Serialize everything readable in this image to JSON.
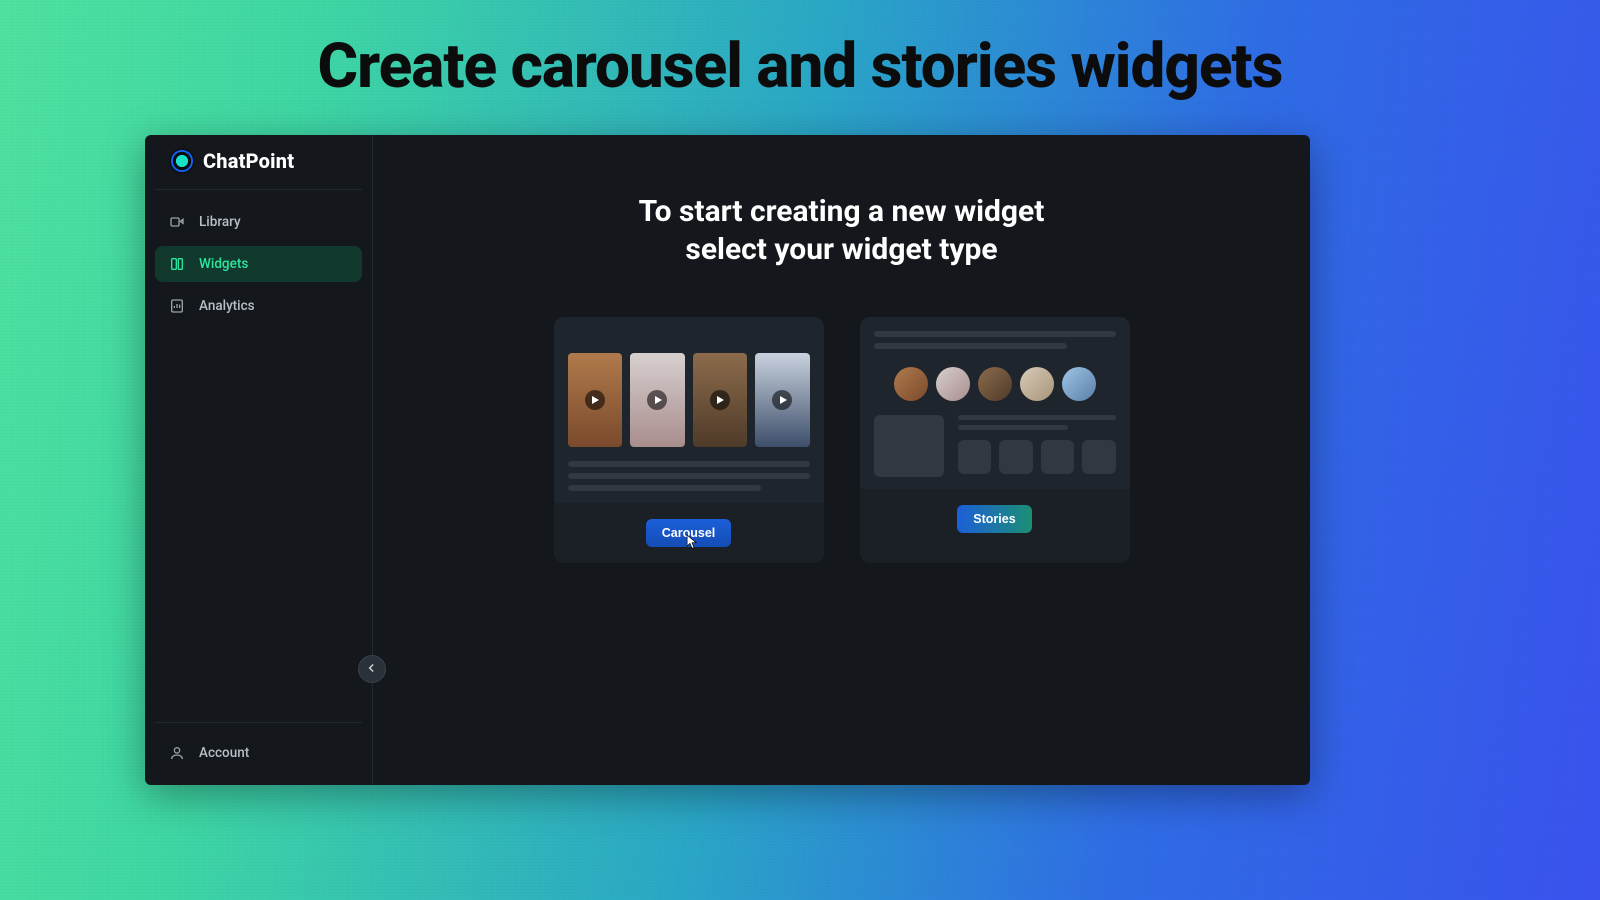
{
  "page_headline": "Create carousel and stories widgets",
  "brand": {
    "name": "ChatPoint"
  },
  "sidebar": {
    "items": [
      {
        "label": "Library",
        "icon": "video-icon"
      },
      {
        "label": "Widgets",
        "icon": "widgets-icon",
        "active": true
      },
      {
        "label": "Analytics",
        "icon": "analytics-icon"
      }
    ],
    "account_label": "Account"
  },
  "main": {
    "title_line1": "To start creating a new widget",
    "title_line2": "select your widget type"
  },
  "cards": {
    "carousel": {
      "button_label": "Carousel"
    },
    "stories": {
      "button_label": "Stories"
    }
  },
  "colors": {
    "accent_green": "#2be69e",
    "button_blue": "#1c5fd8",
    "panel_dark": "#14181d"
  }
}
